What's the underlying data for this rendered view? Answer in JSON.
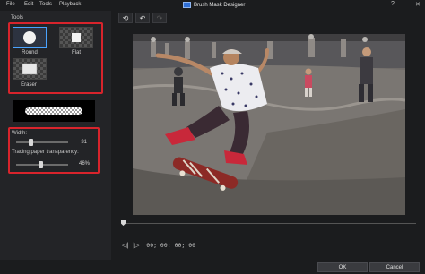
{
  "menu": {
    "file": "File",
    "edit": "Edit",
    "tools": "Tools",
    "playback": "Playback"
  },
  "window": {
    "title": "Brush Mask Designer",
    "help_icon": "?",
    "minimize_icon": "—",
    "close_icon": "✕"
  },
  "tools": {
    "section_label": "Tools",
    "brushes": [
      {
        "label": "Round",
        "icon": "round-brush-icon",
        "selected": true
      },
      {
        "label": "Flat",
        "icon": "flat-brush-icon",
        "selected": false
      },
      {
        "label": "Eraser",
        "icon": "eraser-icon",
        "selected": false
      }
    ]
  },
  "settings": {
    "width_label": "Width:",
    "width_value": "31",
    "width_fraction": 0.28,
    "transparency_label": "Tracing paper transparency:",
    "transparency_value": "46%",
    "transparency_fraction": 0.46
  },
  "toolbar": {
    "reset_icon": "reset-icon",
    "undo_icon": "undo-icon",
    "redo_icon": "redo-icon"
  },
  "playback": {
    "timecode": "00; 00; 00; 00",
    "position_fraction": 0.0
  },
  "footer": {
    "ok_label": "OK",
    "cancel_label": "Cancel"
  },
  "colors": {
    "highlight_box": "#d8242c",
    "selected_brush": "#4aa3ff",
    "background": "#1b1c1e"
  }
}
